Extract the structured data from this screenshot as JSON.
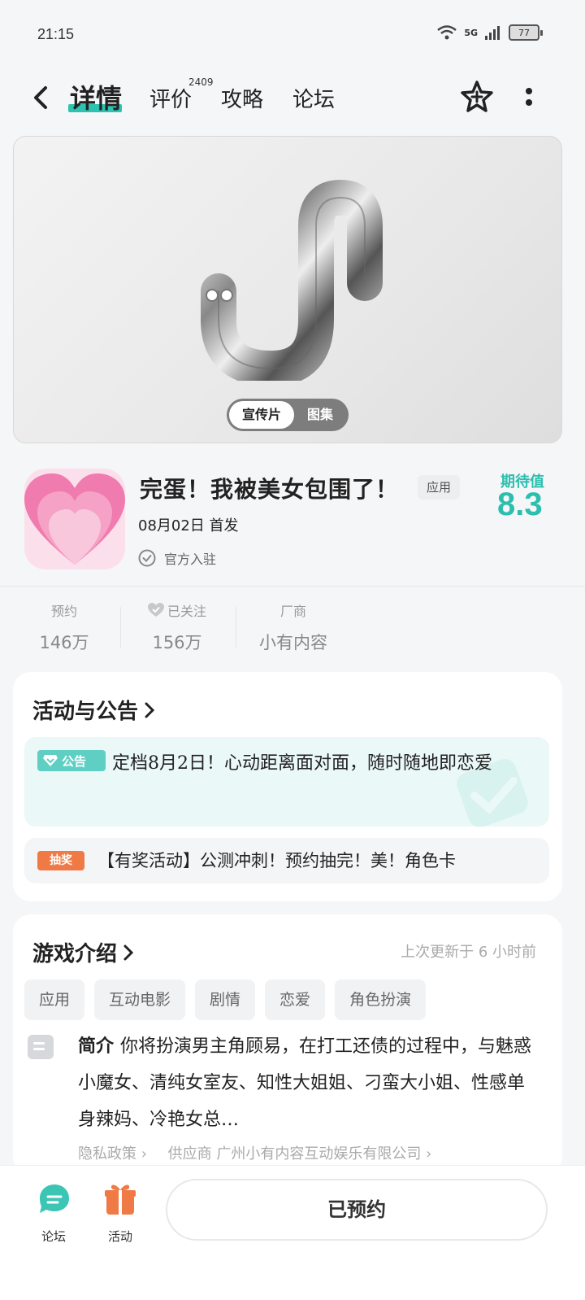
{
  "status_bar": {
    "time": "21:15",
    "network": "5G",
    "battery": "77"
  },
  "nav": {
    "tabs": [
      {
        "label": "详情",
        "active": true
      },
      {
        "label": "评价",
        "badge": "2409"
      },
      {
        "label": "攻略"
      },
      {
        "label": "论坛"
      }
    ]
  },
  "media": {
    "toggle": {
      "video_label": "宣传片",
      "gallery_label": "图集"
    }
  },
  "app": {
    "title": "完蛋！我被美女包围了！",
    "tag": "应用",
    "release": "08月02日 首发",
    "official": "官方入驻",
    "expectation_label": "期待值",
    "expectation_score": "8.3"
  },
  "stats": [
    {
      "label": "预约",
      "value": "146万"
    },
    {
      "label": "已关注",
      "value": "156万"
    },
    {
      "label": "厂商",
      "value": "小有内容"
    }
  ],
  "activities": {
    "title": "活动与公告",
    "notice": {
      "badge": "公告",
      "text": "定档8月2日！心动距离面对面，随时随地即恋爱"
    },
    "raffle": {
      "badge": "抽奖",
      "text": "【有奖活动】公测冲刺！预约抽完！美！角色卡"
    }
  },
  "intro": {
    "title": "游戏介绍",
    "updated": "上次更新于 6 小时前",
    "tags": [
      "应用",
      "互动电影",
      "剧情",
      "恋爱",
      "角色扮演"
    ],
    "label": "简介",
    "text": "你将扮演男主角顾易，在打工还债的过程中，与魅惑小魔女、清纯女室友、知性大姐姐、刁蛮大小姐、性感单身辣妈、冷艳女总…",
    "privacy_link": "隐私政策",
    "supplier_link": "供应商 广州小有内容互动娱乐有限公司"
  },
  "bottom": {
    "forum_label": "论坛",
    "activity_label": "活动",
    "reserve_label": "已预约"
  },
  "colors": {
    "accent": "#2cc3b0",
    "raffle": "#f07a45",
    "icon_pink": "#f48cb5"
  }
}
